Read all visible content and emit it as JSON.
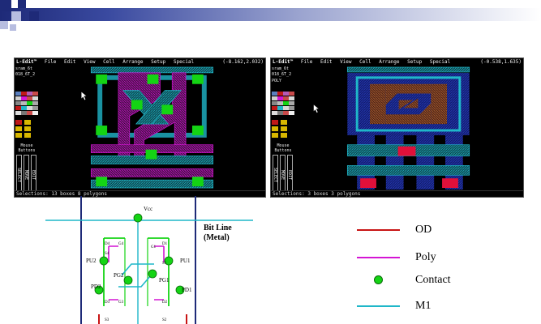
{
  "colors": {
    "od": "#c81414",
    "poly": "#d415d4",
    "contact": "#14d414",
    "m1": "#1fb7c9",
    "header_dark": "#1e2a78"
  },
  "window_left": {
    "app_title": "L-Edit™",
    "menu": [
      "File",
      "Edit",
      "View",
      "Cell",
      "Arrange",
      "Setup",
      "Special"
    ],
    "coords": "(-8.162,2.032)",
    "file_line1": "sram_6t",
    "file_line2": "018_6T_2",
    "mouse_label": "Mouse Buttons",
    "mouse_buttons": [
      "SELECT",
      "MOVE",
      "EDIT"
    ],
    "status": "Selections: 13 boxes  8 polygons"
  },
  "window_right": {
    "app_title": "L-Edit™",
    "menu": [
      "File",
      "Edit",
      "View",
      "Cell",
      "Arrange",
      "Setup",
      "Special"
    ],
    "coords": "(-0.538,1.635)",
    "file_line1": "sram_6t",
    "file_line2": "018_6T_2",
    "layer_label": "POLY",
    "mouse_label": "Mouse Buttons",
    "mouse_buttons": [
      "SELECT",
      "MOVE",
      "EDIT"
    ],
    "status": "Selections: 3 boxes  3 polygons"
  },
  "schematic": {
    "vcc": "Vcc",
    "bit_line": "Bit Line",
    "bit_line_sub": "(Metal)",
    "transistors": [
      "PU2",
      "PU1",
      "PG2",
      "PG1",
      "PD2",
      "PD1"
    ],
    "nodes": [
      "D4",
      "G4",
      "S4",
      "D1",
      "G1",
      "S1",
      "D3",
      "G3",
      "S3",
      "D2",
      "S2"
    ]
  },
  "legend": [
    {
      "label": "OD",
      "kind": "line",
      "color_key": "od"
    },
    {
      "label": "Poly",
      "kind": "line",
      "color_key": "poly"
    },
    {
      "label": "Contact",
      "kind": "dot",
      "color_key": "contact"
    },
    {
      "label": "M1",
      "kind": "line",
      "color_key": "m1"
    }
  ]
}
